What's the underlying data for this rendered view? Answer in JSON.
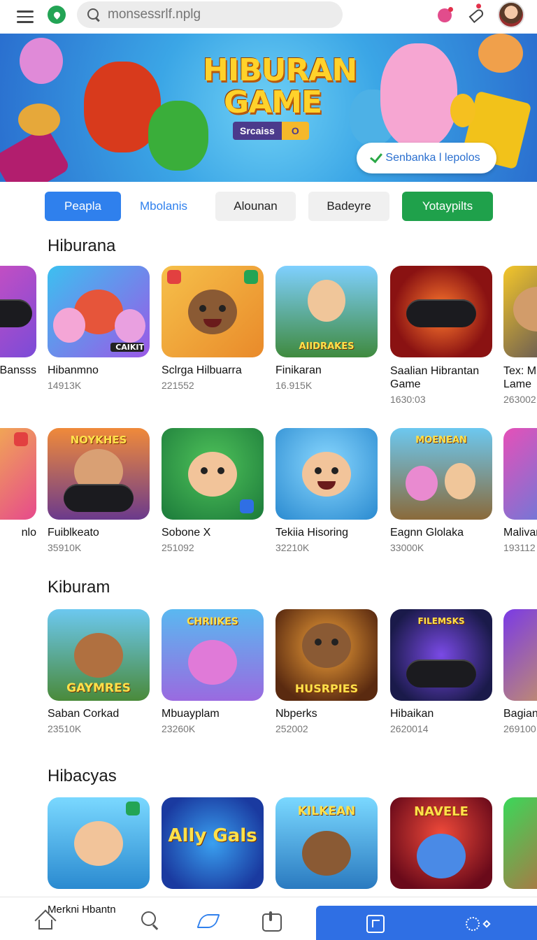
{
  "header": {
    "search_placeholder": "monsessrlf.nplg",
    "menu_icon": "hamburger-menu-icon",
    "shield_icon": "location-shield-icon",
    "game_icon": "game-balloon-icon",
    "rocket_icon": "rocket-icon"
  },
  "hero": {
    "title_line1": "HIBURAN",
    "title_line2": "GAME",
    "badge_left": "Srcaiss",
    "badge_right": "O",
    "cta_label": "Senbanka l lepolos"
  },
  "chips": [
    "Peapla",
    "Mbolanis",
    "Alounan",
    "Badeyre",
    "Yotaypilts"
  ],
  "sections": [
    {
      "title": "Hiburana",
      "rows": [
        [
          {
            "name": "Bansss",
            "meta": ""
          },
          {
            "name": "Hibanmno",
            "meta": "14913K",
            "label": "CAIKIT"
          },
          {
            "name": "Sclrga Hilbuarra",
            "meta": "221552"
          },
          {
            "name": "Finikaran",
            "meta": "16.915K",
            "label": "AIIDRAKES"
          },
          {
            "name": "Saalian Hibrantan Game",
            "meta": "1630:03"
          },
          {
            "name": "Tex: M Lame",
            "meta": "263002"
          }
        ],
        [
          {
            "name": "nlo",
            "meta": ""
          },
          {
            "name": "Fuiblkeato",
            "meta": "35910K",
            "label": "NOYKHES"
          },
          {
            "name": "Sobone X",
            "meta": "251092"
          },
          {
            "name": "Tekiia Hisoring",
            "meta": "32210K"
          },
          {
            "name": "Eagnn Glolaka",
            "meta": "33000K",
            "label": "MOENEAN"
          },
          {
            "name": "Malivar",
            "meta": "193112"
          }
        ]
      ]
    },
    {
      "title": "Kiburam",
      "rows": [
        [
          {
            "name": "Saban Corkad",
            "meta": "23510K",
            "label": "GAYMRES"
          },
          {
            "name": "Mbuayplam",
            "meta": "23260K",
            "label": "CHRIIKES"
          },
          {
            "name": "Nbperks",
            "meta": "252002",
            "label": "HUSRPIES"
          },
          {
            "name": "Hibaikan",
            "meta": "2620014",
            "label": "FILEMSKS"
          },
          {
            "name": "Bagian",
            "meta": "269100"
          }
        ]
      ]
    },
    {
      "title": "Hibacyas",
      "rows": [
        [
          {
            "name": "",
            "meta": ""
          },
          {
            "name": "",
            "meta": "",
            "label": "Ally Gals"
          },
          {
            "name": "",
            "meta": "",
            "label": "KILKEAN"
          },
          {
            "name": "",
            "meta": "",
            "label": "NAVELE"
          },
          {
            "name": "",
            "meta": ""
          }
        ]
      ]
    }
  ],
  "bottom_nav": {
    "label": "Merkni Hbantn",
    "items": [
      "home-icon",
      "search-icon",
      "play-icon",
      "library-icon"
    ],
    "cta_icons": [
      "square-arrow-icon",
      "sun-icon"
    ]
  },
  "colors": {
    "accent_blue": "#2f80ed",
    "accent_green": "#1fa14b",
    "title_yellow": "#ffd22b"
  }
}
